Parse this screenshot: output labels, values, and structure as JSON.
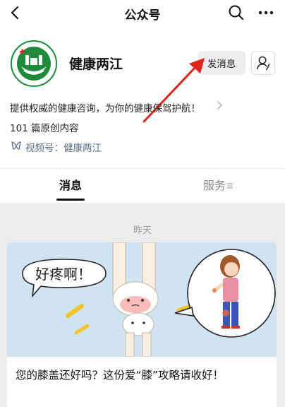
{
  "header": {
    "title": "公众号"
  },
  "account": {
    "name": "健康两江",
    "message_button": "发消息",
    "description": "提供权威的健康咨询，为你的健康保驾护航！",
    "original_count": "101 篇原创内容",
    "channel_label": "视频号：健康两江"
  },
  "tabs": [
    {
      "label": "消息"
    },
    {
      "label": "服务"
    }
  ],
  "feed": {
    "date": "昨天",
    "article": {
      "title": "您的膝盖还好吗？这份爱“膝”攻略请收好！",
      "image_text": "好疼啊！"
    }
  },
  "colors": {
    "brand_green": "#1f8a3b",
    "link_blue": "#5e6b8a",
    "annotation_red": "#e2231a"
  }
}
